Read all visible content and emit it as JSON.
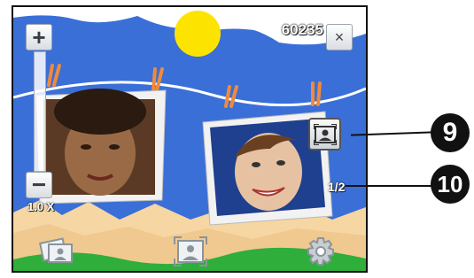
{
  "screen": {
    "counter": "60235",
    "close_label": "×",
    "zoom_in_label": "+",
    "zoom_out_label": "−",
    "zoom_level": "1.0 X",
    "page_indicator": "1/2"
  },
  "callouts": [
    {
      "number": "9",
      "target": "photo-frame-button"
    },
    {
      "number": "10",
      "target": "page-indicator"
    }
  ],
  "icons": {
    "bottom_left": "photo-album-icon",
    "bottom_center": "frame-view-icon",
    "bottom_right": "gear-icon",
    "frame_button": "portrait-frame-icon"
  },
  "colors": {
    "sky": "#3a6fd8",
    "sun": "#fde400",
    "mountain": "#f6d6a2",
    "grass": "#2fae3c",
    "callout": "#111111"
  }
}
